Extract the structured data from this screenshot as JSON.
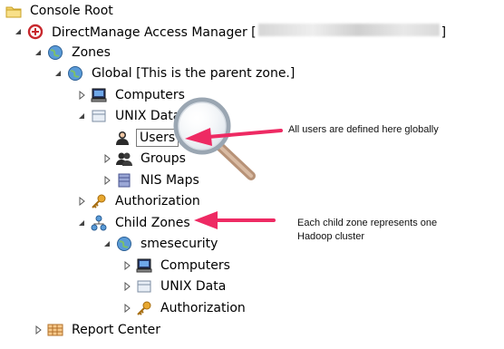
{
  "tree": {
    "console_root": "Console Root",
    "app_name": "DirectManage Access Manager [",
    "app_name_suffix": "]",
    "zones": "Zones",
    "global": "Global [This is the parent zone.]",
    "computers": "Computers",
    "unix_data": "UNIX Data",
    "users": "Users",
    "groups": "Groups",
    "nis_maps": "NIS Maps",
    "authorization": "Authorization",
    "child_zones": "Child Zones",
    "smesecurity": "smesecurity",
    "child_computers": "Computers",
    "child_unix_data": "UNIX Data",
    "child_authorization": "Authorization",
    "report_center": "Report Center"
  },
  "annotations": {
    "users_note": "All users are defined here globally",
    "child_zones_note": "Each child zone represents one Hadoop cluster"
  },
  "colors": {
    "arrow": "#ee2a63",
    "selection_border": "#7a7a7a"
  }
}
